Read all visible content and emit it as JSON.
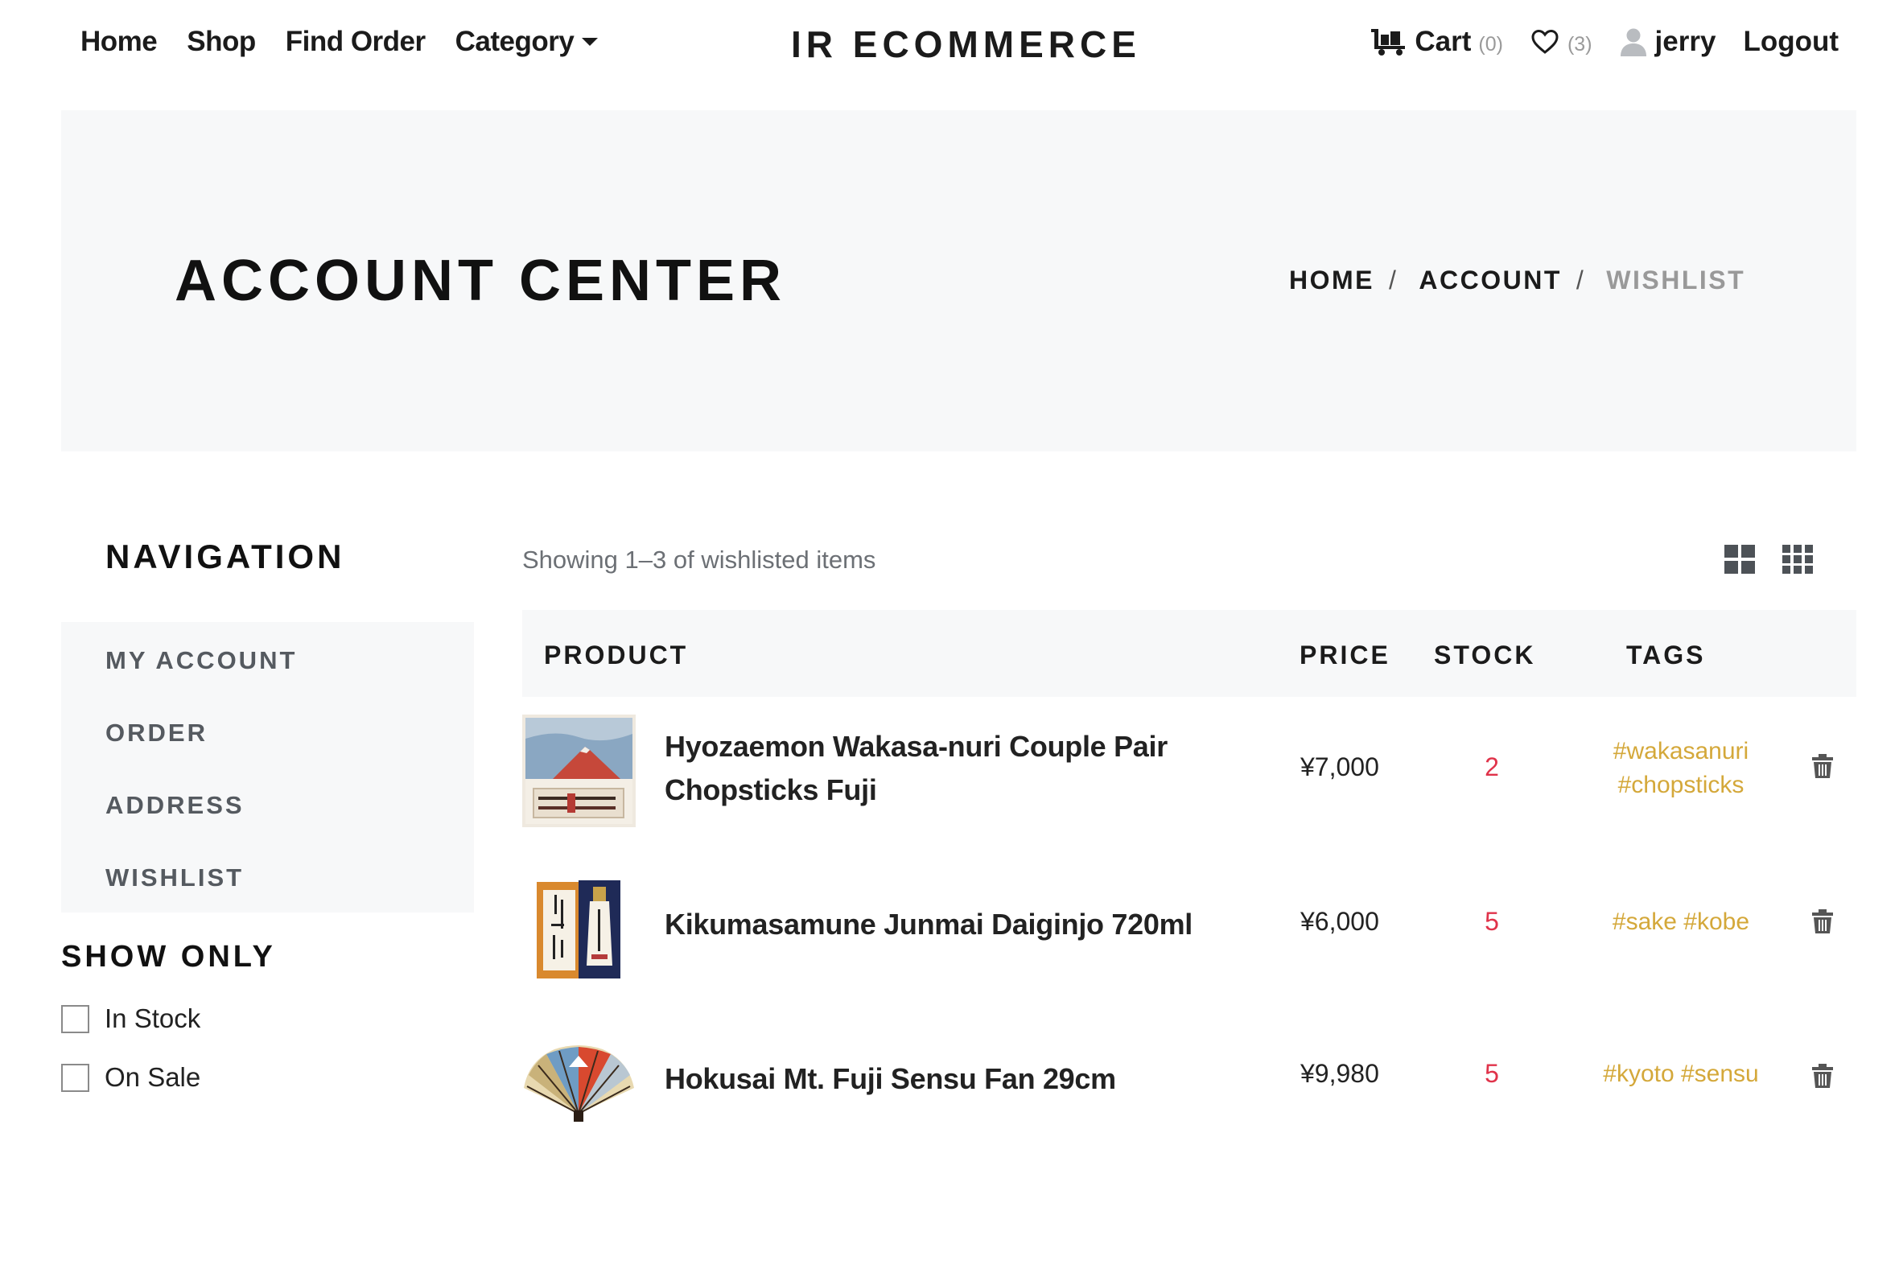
{
  "nav": {
    "home": "Home",
    "shop": "Shop",
    "find_order": "Find Order",
    "category": "Category",
    "brand": "IR ECOMMERCE",
    "cart_label": "Cart",
    "cart_count": "(0)",
    "wishlist_count": "(3)",
    "username": "jerry",
    "logout": "Logout"
  },
  "hero": {
    "title": "ACCOUNT CENTER",
    "breadcrumb": [
      "HOME",
      "ACCOUNT",
      "WISHLIST"
    ],
    "separator": "/"
  },
  "sidebar": {
    "title": "NAVIGATION",
    "items": [
      "MY ACCOUNT",
      "ORDER",
      "ADDRESS",
      "WISHLIST"
    ],
    "show_only_title": "SHOW ONLY",
    "filters": [
      "In Stock",
      "On Sale"
    ]
  },
  "main": {
    "showing_text": "Showing 1–3 of wishlisted items",
    "columns": {
      "product": "PRODUCT",
      "price": "PRICE",
      "stock": "STOCK",
      "tags": "TAGS"
    },
    "items": [
      {
        "name_line1": "Hyozaemon Wakasa-nuri Couple Pair",
        "name_line2": "Chopsticks Fuji",
        "price": "¥7,000",
        "stock": "2",
        "tags_line1": "#wakasanuri",
        "tags_line2": "#chopsticks"
      },
      {
        "name_line1": "Kikumasamune Junmai Daiginjo 720ml",
        "price": "¥6,000",
        "stock": "5",
        "tags_line1": "#sake #kobe"
      },
      {
        "name_line1": "Hokusai Mt. Fuji Sensu Fan 29cm",
        "price": "¥9,980",
        "stock": "5",
        "tags_line1": "#kyoto #sensu"
      }
    ]
  },
  "icons": {
    "cart": "cart-icon",
    "wishlist": "heart-icon",
    "user": "user-icon",
    "grid_large": "grid-large-icon",
    "grid_small": "grid-small-icon",
    "delete": "trash-icon"
  },
  "colors": {
    "stock": "#e0334a",
    "tags": "#d4a83a",
    "panel_bg": "#f7f8f9",
    "muted": "#999999"
  }
}
